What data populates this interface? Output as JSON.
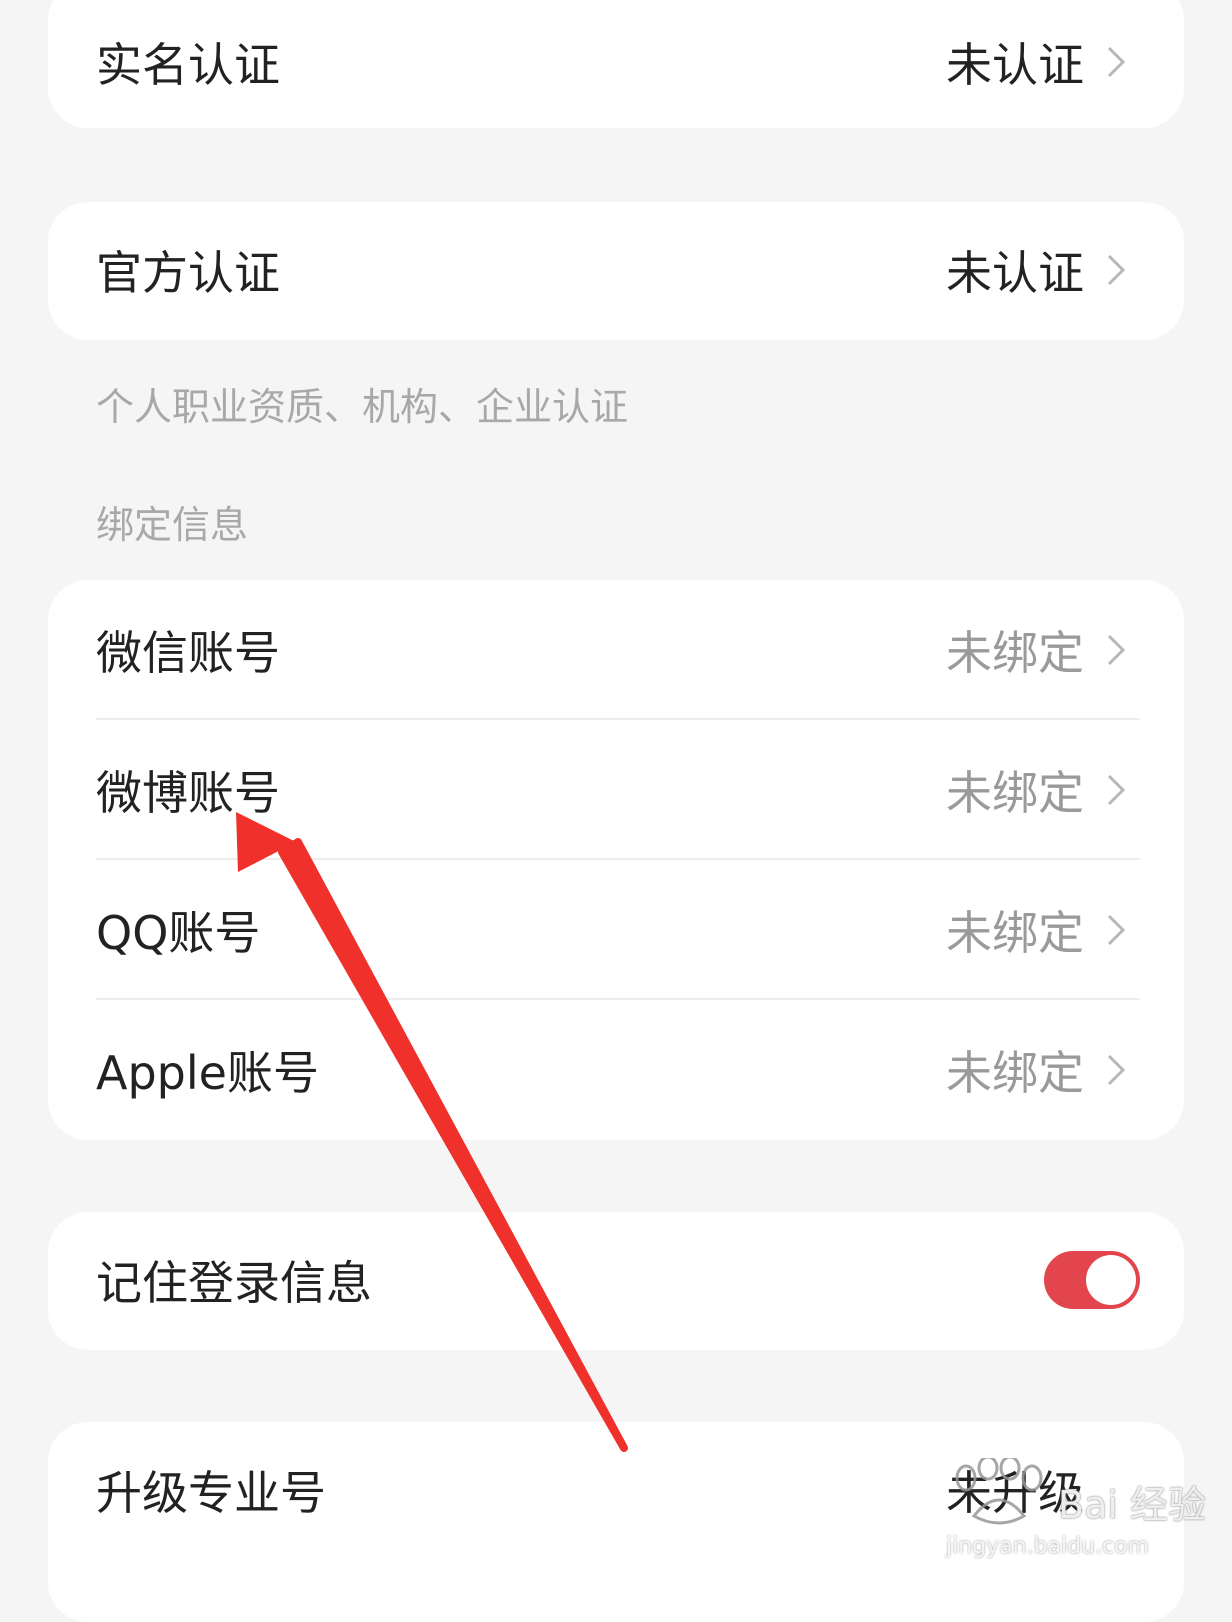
{
  "real_name": {
    "label": "实名认证",
    "value": "未认证"
  },
  "official": {
    "label": "官方认证",
    "value": "未认证",
    "note": "个人职业资质、机构、企业认证"
  },
  "binding": {
    "section_title": "绑定信息",
    "items": [
      {
        "label": "微信账号",
        "value": "未绑定"
      },
      {
        "label": "微博账号",
        "value": "未绑定"
      },
      {
        "label": "QQ账号",
        "value": "未绑定"
      },
      {
        "label": "Apple账号",
        "value": "未绑定"
      }
    ]
  },
  "remember_login": {
    "label": "记住登录信息",
    "enabled": true
  },
  "upgrade": {
    "label": "升级专业号",
    "value": "未升级"
  },
  "watermark": {
    "text": "Bai 经验",
    "url": "jingyan.baidu.com"
  },
  "colors": {
    "background": "#f5f5f5",
    "card": "#ffffff",
    "toggle_on": "#e3454f",
    "annotation_arrow": "#f0302a"
  }
}
